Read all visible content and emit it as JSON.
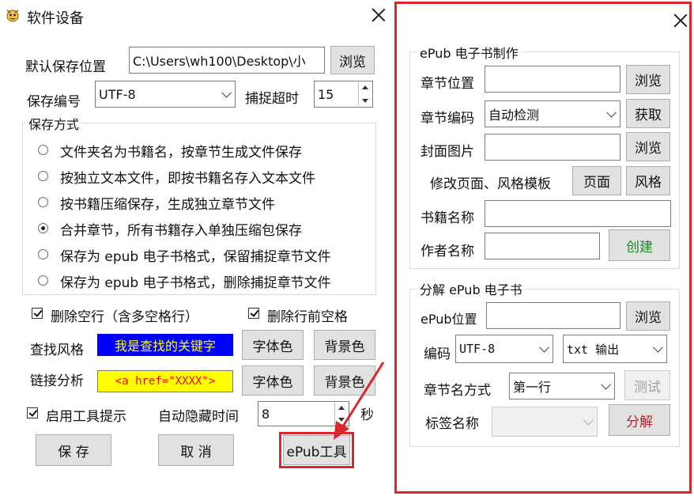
{
  "main": {
    "title": "软件设备",
    "save_location": {
      "label": "默认保存位置",
      "value": "C:\\Users\\wh100\\Desktop\\小",
      "browse": "浏览"
    },
    "encoding": {
      "label": "保存编号",
      "value": "UTF-8"
    },
    "timeout": {
      "label": "捕捉超时",
      "value": "15"
    },
    "save_mode": {
      "title": "保存方式",
      "options": [
        "文件夹名为书籍名，按章节生成文件保存",
        "按独立文本文件，即按书籍名存入文本文件",
        "按书籍压缩保存，生成独立章节文件",
        "合并章节，所有书籍存入单独压缩包保存",
        "保存为 epub 电子书格式，保留捕捉章节文件",
        "保存为 epub 电子书格式，删除捕捉章节文件"
      ],
      "selected_index": 3
    },
    "delete_empty_lines": "删除空行（含多空格行）",
    "delete_leading_spaces": "删除行前空格",
    "find_style": {
      "label": "查找风格",
      "sample": "我是查找的关键字",
      "font_color": "字体色",
      "bg_color": "背景色"
    },
    "link_analysis": {
      "label": "链接分析",
      "sample": "<a href=\"XXXX\">",
      "font_color": "字体色",
      "bg_color": "背景色"
    },
    "tooltip": {
      "label": "启用工具提示"
    },
    "auto_hide": {
      "label": "自动隐藏时间",
      "value": "8",
      "unit": "秒"
    },
    "buttons": {
      "save": "保 存",
      "cancel": "取 消",
      "epub_tool": "ePub工具"
    },
    "colors": {
      "find_bg": "#0000ff",
      "find_fg": "#ffff00",
      "link_bg": "#ffff00",
      "link_fg": "#ff0000",
      "highlight": "#d9272e"
    }
  },
  "epub": {
    "make": {
      "title": "ePub 电子书制作",
      "chapter_location": {
        "label": "章节位置",
        "value": "",
        "browse": "浏览"
      },
      "chapter_encoding": {
        "label": "章节编码",
        "value": "自动检测",
        "fetch": "获取"
      },
      "cover": {
        "label": "封面图片",
        "value": "",
        "browse": "浏览"
      },
      "template": {
        "label": "修改页面、风格模板",
        "page": "页面",
        "style": "风格"
      },
      "book_name": {
        "label": "书籍名称",
        "value": ""
      },
      "author": {
        "label": "作者名称",
        "value": "",
        "create": "创建"
      }
    },
    "split": {
      "title": "分解 ePub 电子书",
      "location": {
        "label": "ePub位置",
        "value": "",
        "browse": "浏览"
      },
      "encoding": {
        "label": "编码",
        "value": "UTF-8"
      },
      "output": {
        "value": "txt 输出"
      },
      "chapter_mode": {
        "label": "章节名方式",
        "value": "第一行",
        "test": "测试"
      },
      "tag": {
        "label": "标签名称",
        "value": "",
        "split": "分解"
      }
    }
  }
}
